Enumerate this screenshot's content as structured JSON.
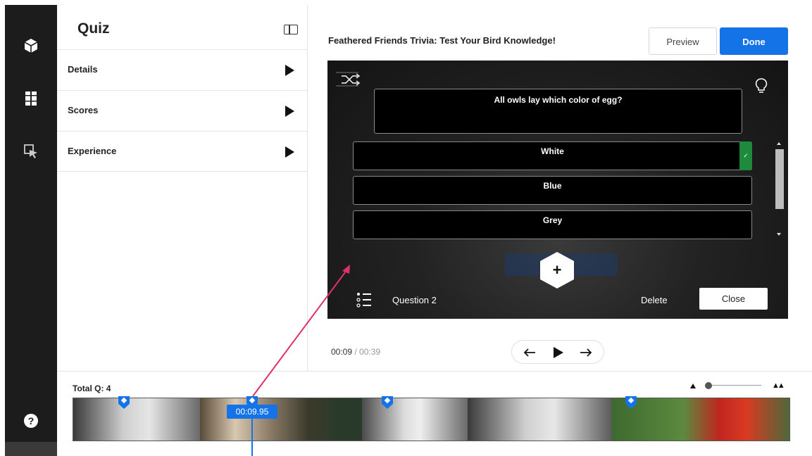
{
  "panel": {
    "title": "Quiz",
    "sections": [
      "Details",
      "Scores",
      "Experience"
    ]
  },
  "header": {
    "quiz_title": "Feathered Friends Trivia: Test Your Bird Knowledge!",
    "preview_label": "Preview",
    "done_label": "Done"
  },
  "stage": {
    "question": "All owls lay which color of egg?",
    "answers": [
      "White",
      "Blue",
      "Grey"
    ],
    "correct_answer_index": 0,
    "question_label": "Question 2",
    "delete_label": "Delete",
    "close_label": "Close",
    "add_symbol": "+"
  },
  "player": {
    "current_time": "00:09",
    "separator": " / ",
    "duration": "00:39"
  },
  "timeline": {
    "total_label": "Total Q: 4",
    "playhead_time": "00:09.95"
  },
  "rail": {
    "help_symbol": "?"
  },
  "colors": {
    "accent": "#1473e6",
    "correct": "#1e8a3c",
    "rail": "#1c1c1c",
    "stage": "#1e1e1e",
    "annotation_arrow": "#e0306e"
  }
}
